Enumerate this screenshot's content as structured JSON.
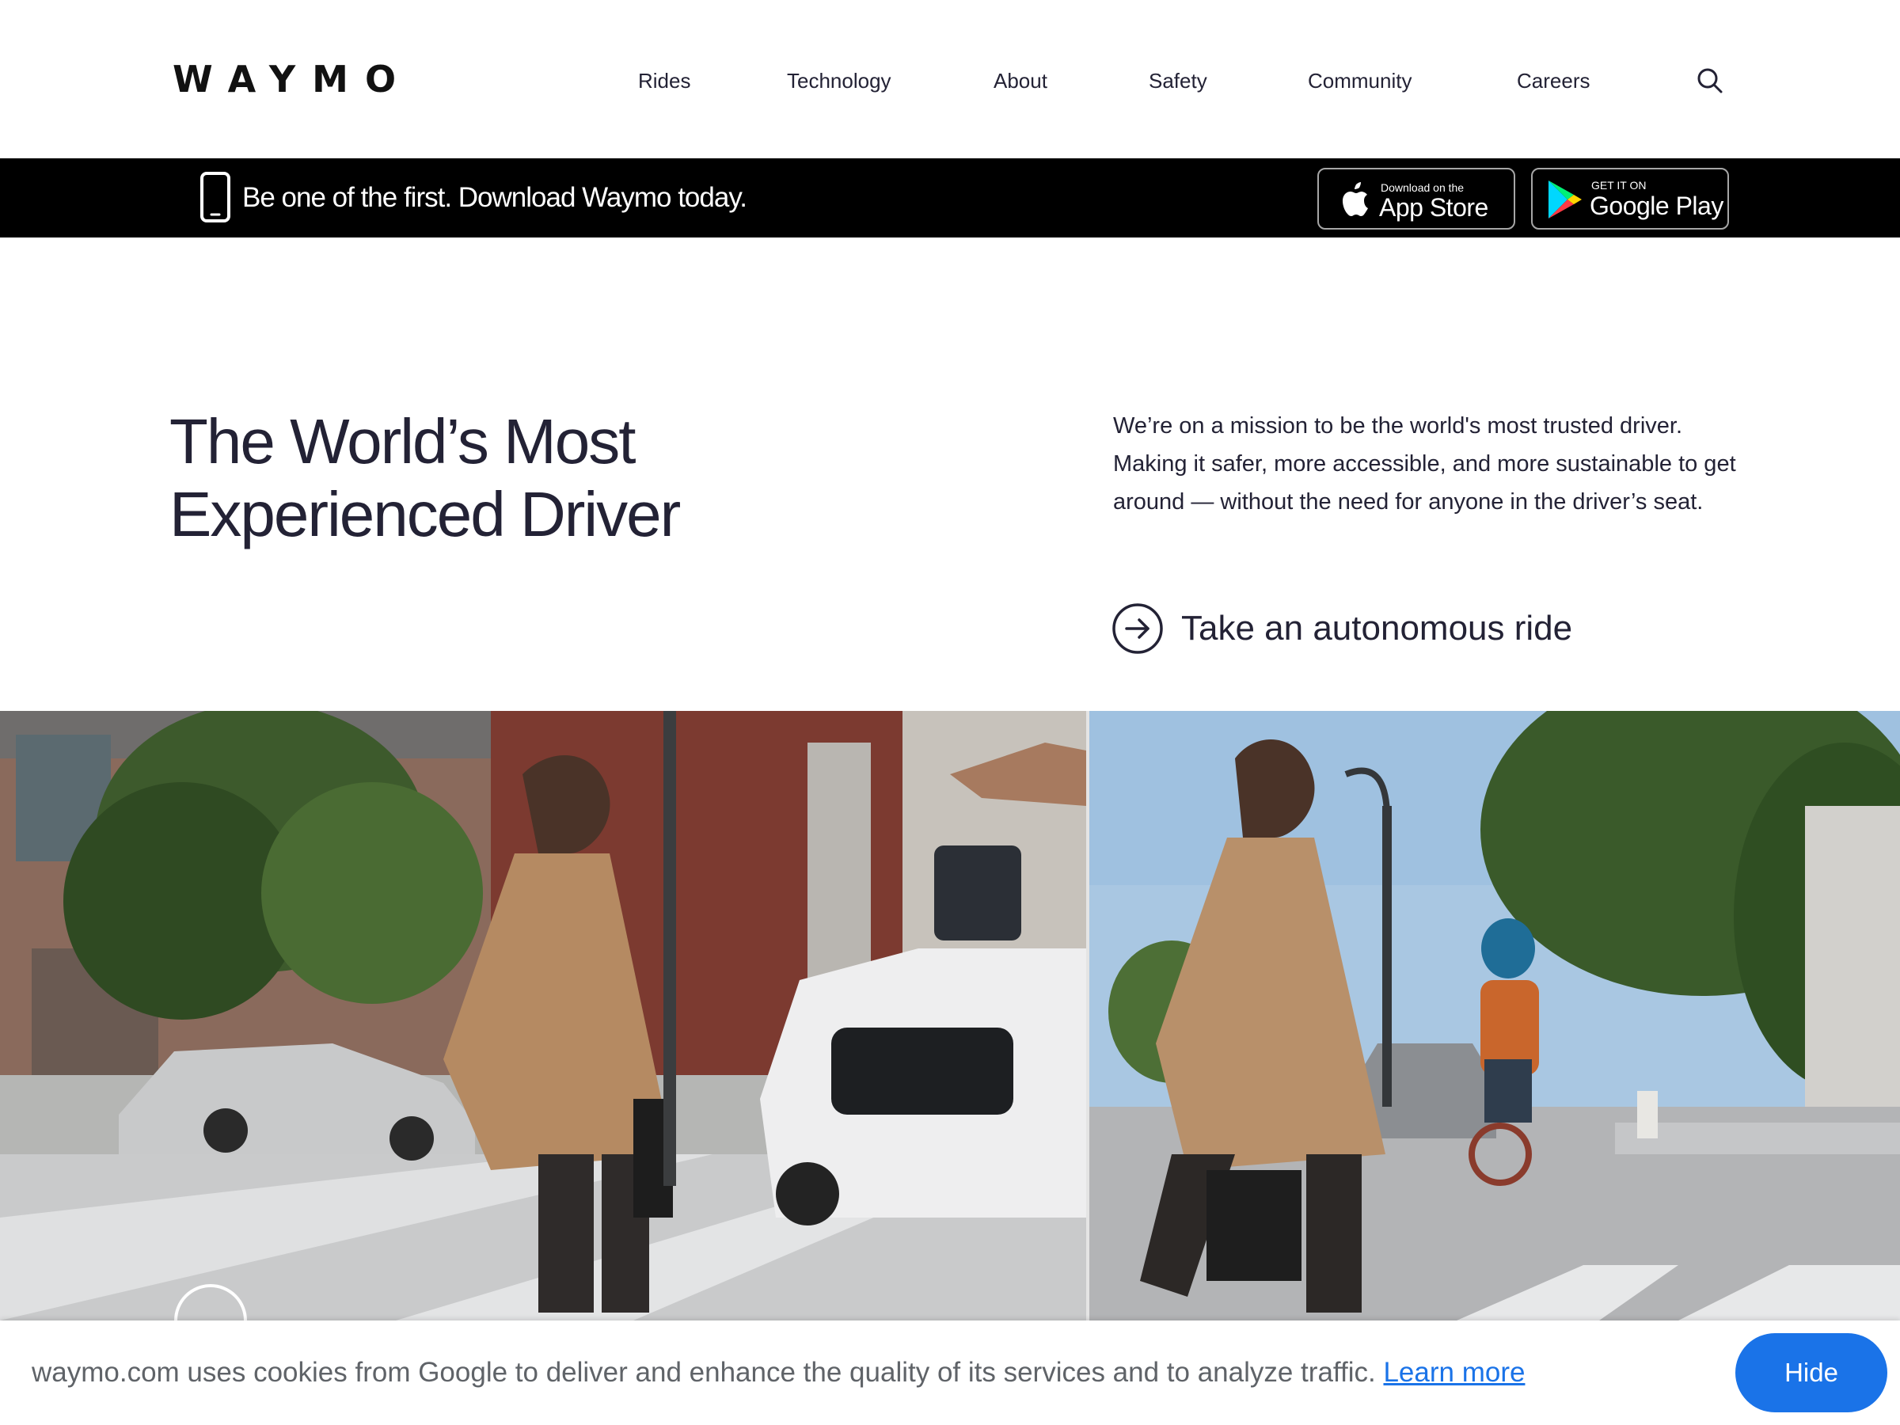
{
  "header": {
    "logo": "WAYMO",
    "nav": [
      "Rides",
      "Technology",
      "About",
      "Safety",
      "Community",
      "Careers"
    ],
    "search_icon": "search-icon"
  },
  "banner": {
    "text": "Be one of the first. Download Waymo today.",
    "app_store": {
      "small": "Download on the",
      "big": "App Store"
    },
    "google_play": {
      "small": "GET IT ON",
      "big": "Google Play"
    }
  },
  "hero": {
    "title_line1": "The World’s Most",
    "title_line2": "Experienced Driver",
    "description": "We’re on a mission to be the world's most trusted driver. Making it safer, more accessible, and more sustainable to get around — without the need for anyone in the driver’s seat.",
    "cta_label": "Take an autonomous ride"
  },
  "cookie": {
    "text": "waymo.com uses cookies from Google to deliver and enhance the quality of its services and to analyze traffic.",
    "link": "Learn more",
    "button": "Hide"
  },
  "colors": {
    "text": "#232235",
    "banner_bg": "#000000",
    "accent_blue": "#1a73e8",
    "cookie_text": "#5f6368"
  }
}
